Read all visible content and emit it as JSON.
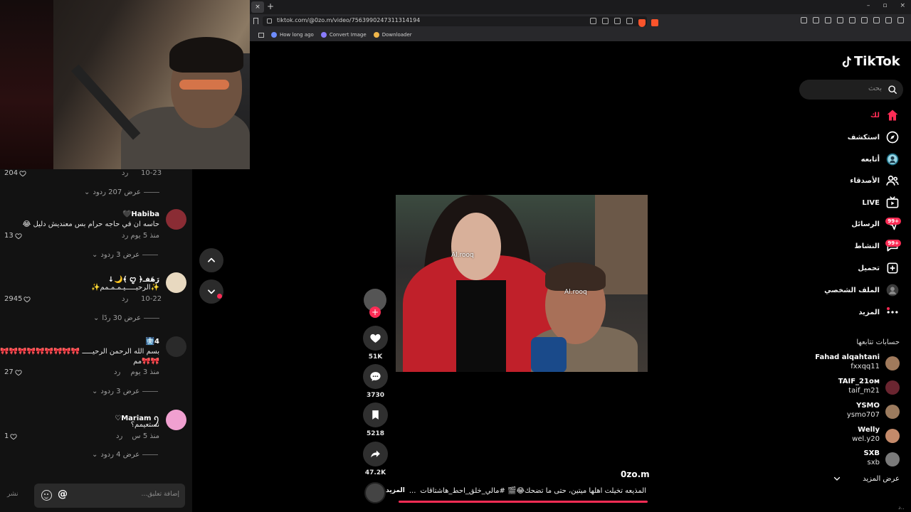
{
  "browser": {
    "tab_close": "×",
    "new_tab": "+",
    "url": "tiktok.com/@0zo.m/video/7563990247311314194",
    "window_controls": [
      "–",
      "▫",
      "×"
    ],
    "bookmarks": [
      {
        "label": "How long ago",
        "color": "#6e8cff"
      },
      {
        "label": "Convert Image",
        "color": "#8a7cff"
      },
      {
        "label": "Downloader",
        "color": "#f0b64a"
      }
    ]
  },
  "comments": {
    "top_meta": {
      "time": "10-23",
      "reply": "رد",
      "likes": "204"
    },
    "items": [
      {
        "replies_label": "عرض 207 ردود",
        "name": "Habiba🖤",
        "text": "حاسه ان في حاجه حرام بس معنديش دليل 😂",
        "time": "منذ 5 يوم",
        "reply": "رد",
        "likes": "13",
        "avatar_color": "#8a2c34"
      },
      {
        "replies_label": "عرض 3 ردود",
        "name": "رَهَفـ﴿ ꨄ ﴾🌙↓",
        "text": "✨الرحيـــــيـمـمـمم✨",
        "time": "10-22",
        "reply": "رد",
        "likes": "2945",
        "avatar_color": "#e8d9c0"
      },
      {
        "replies_label": "عرض 30 ردًا",
        "name": "4🩻",
        "text": "بسم الله الرحمن الرحيـــــ 🎀🎀🎀🎀🎀🎀🎀🎀🎀🎀",
        "text2": "🎀🎀مم",
        "time": "منذ 3 يوم",
        "reply": "رد",
        "likes": "27",
        "avatar_color": "#3a3a3a"
      },
      {
        "replies_label": "عرض 3 ردود",
        "name": "Mariam ꪆ♡",
        "text": "نستعيمم؟",
        "time": "منذ 5 س",
        "reply": "رد",
        "likes": "1",
        "avatar_color": "#f0a0d0"
      }
    ],
    "last_replies_label": "عرض 4 ردود",
    "input_placeholder": "إضافة تعليق...",
    "at_symbol": "@",
    "post_label": "نشر"
  },
  "video": {
    "watermark": "Al.rooq",
    "author": "0zo.m",
    "caption": "المذيعه تخيلت اهلها ميتين، حتى ما تضحك😂🎬 #مالي_خلق_احط_هاشتاقات",
    "caption_more": "المزيد",
    "ellipsis": "...",
    "follow_plus": "+"
  },
  "actions": {
    "likes": "51K",
    "comments": "3730",
    "saves": "5218",
    "shares": "47.2K"
  },
  "sidebar": {
    "brand": "TikTok",
    "search_placeholder": "بحث",
    "nav": [
      {
        "label": "لك",
        "icon": "home-icon",
        "active": true
      },
      {
        "label": "استكشف",
        "icon": "compass-icon"
      },
      {
        "label": "أتابعه",
        "icon": "following-icon"
      },
      {
        "label": "الأصدقاء",
        "icon": "friends-icon"
      },
      {
        "label": "LIVE",
        "icon": "live-icon"
      },
      {
        "label": "الرسائل",
        "icon": "messages-icon",
        "badge": "99+"
      },
      {
        "label": "النشاط",
        "icon": "activity-icon",
        "badge": "99+"
      },
      {
        "label": "تحميل",
        "icon": "upload-icon"
      },
      {
        "label": "الملف الشخصي",
        "icon": "profile-icon"
      },
      {
        "label": "المزيد",
        "icon": "more-icon"
      }
    ],
    "following_title": "حسابات تتابعها",
    "following": [
      {
        "name": "Fahad alqahtani",
        "user": "fxxqq11",
        "color": "#a07a5c"
      },
      {
        "name": "TAIF_21ᴏᴍ",
        "user": "taif_m21",
        "color": "#6a2530"
      },
      {
        "name": "YSMO",
        "user": "ysmo707",
        "color": "#9c7b5e"
      },
      {
        "name": "Welly",
        "user": "wel.y20",
        "color": "#c48a6a"
      },
      {
        "name": "SXB",
        "user": "sxb",
        "color": "#7a7a7a"
      }
    ],
    "see_more": "عرض المزيد",
    "bottom_glyph": "د.."
  }
}
